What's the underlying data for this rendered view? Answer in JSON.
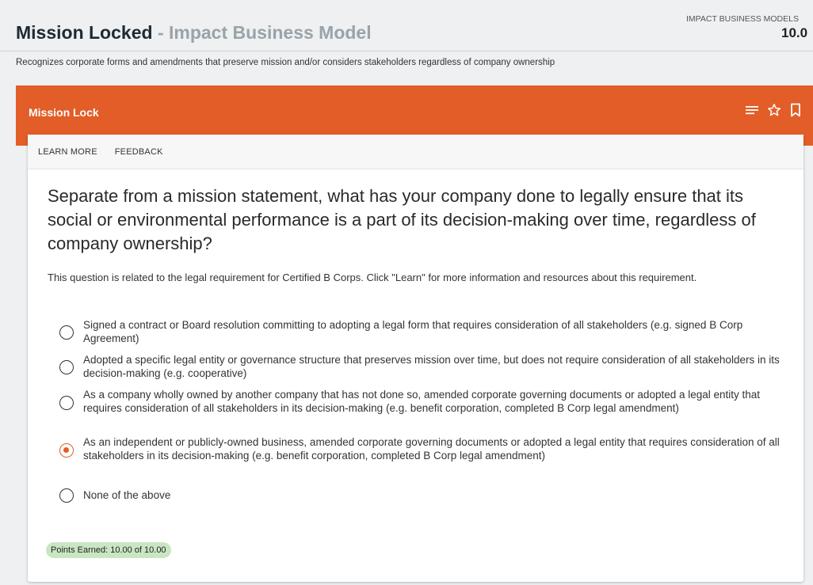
{
  "header": {
    "title": "Mission Locked",
    "separator": "-",
    "subtitle": "Impact Business Model",
    "score_label": "IMPACT BUSINESS MODELS",
    "score_value": "10.0"
  },
  "description": "Recognizes corporate forms and amendments that preserve mission and/or considers stakeholders regardless of company ownership",
  "section": {
    "title": "Mission Lock",
    "icons": [
      "menu-icon",
      "star-icon",
      "bookmark-icon"
    ]
  },
  "tabs": [
    {
      "label": "LEARN MORE"
    },
    {
      "label": "FEEDBACK"
    }
  ],
  "question": "Separate from a mission statement, what has your company done to legally ensure that its social or environmental performance is a part of its decision-making over time, regardless of company ownership?",
  "note": "This question is related to the legal requirement for Certified B Corps. Click \"Learn\" for more information and resources about this requirement.",
  "options": [
    {
      "label": "Signed a contract or Board resolution committing to adopting a legal form that requires consideration of all stakeholders (e.g. signed B Corp Agreement)",
      "selected": false
    },
    {
      "label": "Adopted a specific legal entity or governance structure that preserves mission over time, but does not require consideration of all stakeholders in its decision-making (e.g. cooperative)",
      "selected": false
    },
    {
      "label": "As a company wholly owned by another company that has not done so, amended corporate governing documents or adopted a legal entity that requires consideration of all stakeholders in its decision-making (e.g. benefit corporation, completed B Corp legal amendment)",
      "selected": false
    },
    {
      "label": "As an independent or publicly-owned business, amended corporate governing documents or adopted a legal entity that requires consideration of all stakeholders in its decision-making (e.g. benefit corporation, completed B Corp legal amendment)",
      "selected": true
    },
    {
      "label": "None of the above",
      "selected": false
    }
  ],
  "points": "Points Earned: 10.00 of 10.00",
  "colors": {
    "accent": "#e25d27",
    "badge": "#c9e6c3"
  }
}
